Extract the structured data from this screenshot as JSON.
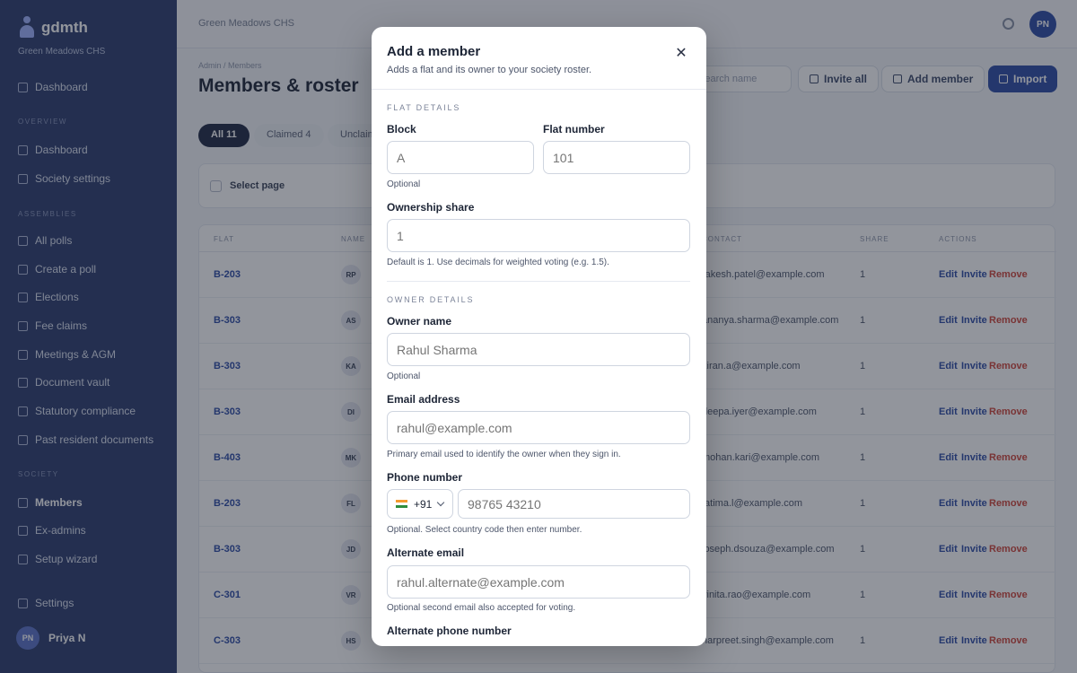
{
  "sidebar": {
    "brand": "gdmth",
    "society": "Green Meadows CHS",
    "sections": [
      "OVERVIEW",
      "ASSEMBLIES",
      "SOCIETY"
    ],
    "items": [
      {
        "label": "Dashboard",
        "icon": "home-icon"
      },
      {
        "label": "Dashboard",
        "icon": "grid-icon"
      },
      {
        "label": "Society settings",
        "icon": "settings-icon"
      },
      {
        "label": "All polls",
        "icon": "list-icon"
      },
      {
        "label": "Create a poll",
        "icon": "plus-icon"
      },
      {
        "label": "Elections",
        "icon": "ballot-icon"
      },
      {
        "label": "Fee claims",
        "icon": "receipt-icon"
      },
      {
        "label": "Meetings & AGM",
        "icon": "calendar-icon"
      },
      {
        "label": "Document vault",
        "icon": "folder-icon"
      },
      {
        "label": "Statutory compliance",
        "icon": "shield-icon"
      },
      {
        "label": "Past resident documents",
        "icon": "archive-icon"
      },
      {
        "label": "Members",
        "icon": "users-icon"
      },
      {
        "label": "Ex-admins",
        "icon": "user-icon"
      },
      {
        "label": "Setup wizard",
        "icon": "wand-icon"
      },
      {
        "label": "Settings",
        "icon": "gear-icon"
      }
    ],
    "user": {
      "initials": "PN",
      "name": "Priya N"
    }
  },
  "topbar": {
    "title": "Green Meadows CHS",
    "avatar_initials": "PN"
  },
  "page": {
    "breadcrumb": "Admin / Members",
    "title": "Members & roster",
    "search_placeholder": "Search name",
    "buttons": {
      "invite_all": "Invite all",
      "add_member": "Add member",
      "import": "Import"
    },
    "filters": [
      {
        "label": "All 11"
      },
      {
        "label": "Claimed 4"
      },
      {
        "label": "Unclaimed"
      }
    ],
    "select_page": "Select page",
    "columns": [
      "FLAT",
      "NAME",
      "CONTACT",
      "SHARE",
      "ACTIONS"
    ],
    "rows": [
      {
        "flat": "B-203",
        "initials": "RP",
        "email": "rakesh.patel@example.com",
        "share": "1"
      },
      {
        "flat": "B-303",
        "initials": "AS",
        "email": "ananya.sharma@example.com",
        "share": "1"
      },
      {
        "flat": "B-303",
        "initials": "KA",
        "email": "kiran.a@example.com",
        "share": "1"
      },
      {
        "flat": "B-303",
        "initials": "DI",
        "email": "deepa.iyer@example.com",
        "share": "1"
      },
      {
        "flat": "B-403",
        "initials": "MK",
        "email": "mohan.kari@example.com",
        "share": "1"
      },
      {
        "flat": "B-203",
        "initials": "FL",
        "email": "fatima.l@example.com",
        "share": "1"
      },
      {
        "flat": "B-303",
        "initials": "JD",
        "email": "joseph.dsouza@example.com",
        "share": "1"
      },
      {
        "flat": "C-301",
        "initials": "VR",
        "email": "vinita.rao@example.com",
        "share": "1"
      },
      {
        "flat": "C-303",
        "initials": "HS",
        "email": "harpreet.singh@example.com",
        "share": "1"
      }
    ],
    "actions": {
      "edit": "Edit",
      "invite": "Invite",
      "remove": "Remove"
    }
  },
  "modal": {
    "title": "Add a member",
    "subtitle": "Adds a flat and its owner to your society roster.",
    "flat_section": "FLAT DETAILS",
    "block_label": "Block",
    "block_placeholder": "A",
    "block_help": "Optional",
    "flat_label": "Flat number",
    "flat_placeholder": "101",
    "share_label": "Ownership share",
    "share_placeholder": "1",
    "share_help": "Default is 1. Use decimals for weighted voting (e.g. 1.5).",
    "owner_section": "OWNER DETAILS",
    "owner_label": "Owner name",
    "owner_placeholder": "Rahul Sharma",
    "owner_help": "Optional",
    "email_label": "Email address",
    "email_placeholder": "rahul@example.com",
    "email_help": "Primary email used to identify the owner when they sign in.",
    "phone_label": "Phone number",
    "country_code": "+91",
    "phone_placeholder": "98765 43210",
    "phone_help": "Optional. Select country code then enter number.",
    "alt_email_label": "Alternate email",
    "alt_email_placeholder": "rahul.alternate@example.com",
    "alt_email_help": "Optional second email also accepted for voting.",
    "alt_phone_label": "Alternate phone number"
  },
  "colors": {
    "sidebar": "#2c3d6e",
    "primary": "#2d4ba6",
    "danger": "#d0453a"
  }
}
